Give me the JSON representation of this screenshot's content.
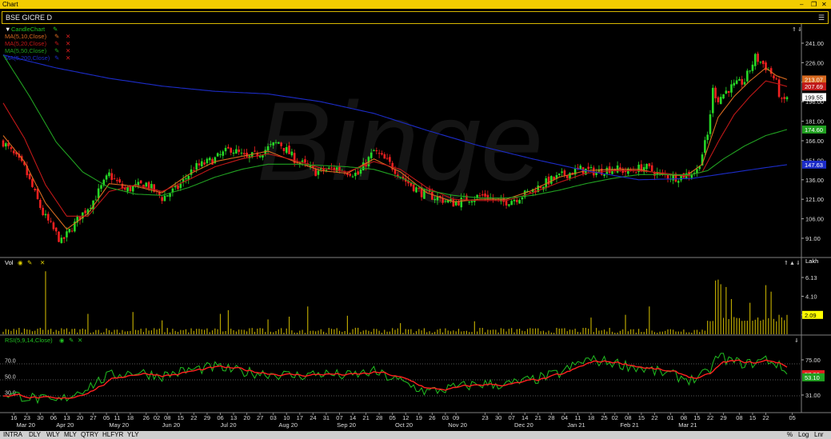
{
  "window": {
    "title": "Chart"
  },
  "symbol_bar": {
    "symbol": "BSE GICRE D"
  },
  "watermark": "Binge",
  "price_panel": {
    "label": "CandleChart",
    "indicators": [
      {
        "label": "MA(5,10,Close)",
        "color": "#d86a20"
      },
      {
        "label": "MA(5,20,Close)",
        "color": "#c01818"
      },
      {
        "label": "MA(5,50,Close)",
        "color": "#21a021"
      },
      {
        "label": "MA(5,200,Close)",
        "color": "#1c2cc8"
      }
    ],
    "yticks": [
      "241.00",
      "226.00",
      "211.00",
      "196.00",
      "181.00",
      "166.00",
      "151.00",
      "136.00",
      "121.00",
      "106.00",
      "91.00"
    ],
    "price_tags": [
      {
        "text": "213.07",
        "value": 213.07,
        "bg": "#d86a20"
      },
      {
        "text": "207.69",
        "value": 207.69,
        "bg": "#c01818"
      },
      {
        "text": "199.55",
        "value": 199.55,
        "bg": "#ffffff"
      },
      {
        "text": "174.60",
        "value": 174.6,
        "bg": "#21a021"
      },
      {
        "text": "147.63",
        "value": 147.63,
        "bg": "#1c2cc8"
      }
    ]
  },
  "volume_panel": {
    "label": "Vol",
    "unit": "Lakh",
    "yticks": [
      "6.13",
      "4.10",
      "2.09"
    ],
    "last_value": "2.09"
  },
  "rsi_panel": {
    "label": "RSI(5,9,14,Close)",
    "yticks": [
      "75.00",
      "31.00"
    ],
    "levels": [
      "70.0",
      "50.0",
      "30.0"
    ],
    "tags": [
      {
        "text": "57.06",
        "value": 57.06,
        "bg": "#e02020"
      },
      {
        "text": "53.10",
        "value": 53.1,
        "bg": "#21a021"
      }
    ]
  },
  "chart_data": {
    "type": "candlestick",
    "title": "BSE GICRE D",
    "period": "Mar 2020 - Mar 2021 (daily)",
    "ylim": [
      80,
      250
    ],
    "close_anchors": [
      [
        0,
        165
      ],
      [
        8,
        145
      ],
      [
        15,
        110
      ],
      [
        22,
        88
      ],
      [
        28,
        105
      ],
      [
        34,
        120
      ],
      [
        40,
        140
      ],
      [
        46,
        128
      ],
      [
        54,
        133
      ],
      [
        60,
        122
      ],
      [
        66,
        130
      ],
      [
        72,
        145
      ],
      [
        80,
        152
      ],
      [
        86,
        160
      ],
      [
        92,
        152
      ],
      [
        98,
        158
      ],
      [
        104,
        165
      ],
      [
        110,
        152
      ],
      [
        118,
        142
      ],
      [
        126,
        145
      ],
      [
        134,
        140
      ],
      [
        140,
        158
      ],
      [
        146,
        148
      ],
      [
        152,
        135
      ],
      [
        158,
        126
      ],
      [
        164,
        122
      ],
      [
        170,
        118
      ],
      [
        176,
        122
      ],
      [
        182,
        124
      ],
      [
        188,
        118
      ],
      [
        194,
        122
      ],
      [
        200,
        128
      ],
      [
        206,
        135
      ],
      [
        212,
        140
      ],
      [
        218,
        144
      ],
      [
        224,
        142
      ],
      [
        230,
        145
      ],
      [
        236,
        142
      ],
      [
        242,
        146
      ],
      [
        248,
        140
      ],
      [
        254,
        138
      ],
      [
        258,
        140
      ],
      [
        262,
        143
      ],
      [
        266,
        170
      ],
      [
        268,
        205
      ],
      [
        270,
        198
      ],
      [
        274,
        206
      ],
      [
        280,
        212
      ],
      [
        284,
        230
      ],
      [
        287,
        225
      ],
      [
        290,
        218
      ],
      [
        292,
        210
      ],
      [
        294,
        195
      ],
      [
        296,
        199.55
      ]
    ],
    "moving_averages": {
      "MA10": [
        [
          0,
          170
        ],
        [
          8,
          150
        ],
        [
          16,
          118
        ],
        [
          24,
          98
        ],
        [
          32,
          110
        ],
        [
          40,
          133
        ],
        [
          50,
          131
        ],
        [
          60,
          126
        ],
        [
          70,
          140
        ],
        [
          80,
          150
        ],
        [
          90,
          154
        ],
        [
          100,
          158
        ],
        [
          110,
          150
        ],
        [
          120,
          143
        ],
        [
          130,
          141
        ],
        [
          140,
          152
        ],
        [
          150,
          142
        ],
        [
          160,
          126
        ],
        [
          170,
          119
        ],
        [
          180,
          121
        ],
        [
          190,
          121
        ],
        [
          200,
          128
        ],
        [
          210,
          138
        ],
        [
          220,
          143
        ],
        [
          230,
          144
        ],
        [
          240,
          144
        ],
        [
          250,
          140
        ],
        [
          258,
          139
        ],
        [
          264,
          148
        ],
        [
          270,
          184
        ],
        [
          276,
          200
        ],
        [
          282,
          212
        ],
        [
          288,
          222
        ],
        [
          292,
          216
        ],
        [
          296,
          213.07
        ]
      ],
      "MA20": [
        [
          0,
          195
        ],
        [
          8,
          168
        ],
        [
          16,
          132
        ],
        [
          24,
          108
        ],
        [
          32,
          108
        ],
        [
          40,
          127
        ],
        [
          50,
          132
        ],
        [
          60,
          127
        ],
        [
          70,
          136
        ],
        [
          80,
          146
        ],
        [
          90,
          152
        ],
        [
          100,
          156
        ],
        [
          110,
          151
        ],
        [
          120,
          145
        ],
        [
          130,
          142
        ],
        [
          140,
          150
        ],
        [
          150,
          144
        ],
        [
          160,
          130
        ],
        [
          170,
          121
        ],
        [
          180,
          120
        ],
        [
          190,
          120
        ],
        [
          200,
          126
        ],
        [
          210,
          134
        ],
        [
          220,
          141
        ],
        [
          230,
          143
        ],
        [
          240,
          143
        ],
        [
          250,
          141
        ],
        [
          258,
          139
        ],
        [
          264,
          142
        ],
        [
          270,
          165
        ],
        [
          276,
          186
        ],
        [
          282,
          200
        ],
        [
          288,
          212
        ],
        [
          292,
          210
        ],
        [
          296,
          207.69
        ]
      ],
      "MA50": [
        [
          0,
          232
        ],
        [
          10,
          200
        ],
        [
          20,
          165
        ],
        [
          30,
          142
        ],
        [
          40,
          130
        ],
        [
          50,
          125
        ],
        [
          60,
          124
        ],
        [
          70,
          130
        ],
        [
          80,
          138
        ],
        [
          90,
          144
        ],
        [
          100,
          148
        ],
        [
          110,
          148
        ],
        [
          120,
          147
        ],
        [
          130,
          146
        ],
        [
          140,
          144
        ],
        [
          150,
          138
        ],
        [
          160,
          128
        ],
        [
          170,
          124
        ],
        [
          180,
          122
        ],
        [
          190,
          122
        ],
        [
          200,
          124
        ],
        [
          210,
          128
        ],
        [
          220,
          133
        ],
        [
          230,
          137
        ],
        [
          240,
          140
        ],
        [
          250,
          140
        ],
        [
          260,
          140
        ],
        [
          266,
          143
        ],
        [
          272,
          152
        ],
        [
          280,
          162
        ],
        [
          288,
          170
        ],
        [
          296,
          174.6
        ]
      ],
      "MA200": [
        [
          0,
          232
        ],
        [
          20,
          222
        ],
        [
          40,
          214
        ],
        [
          60,
          208
        ],
        [
          80,
          204
        ],
        [
          100,
          202
        ],
        [
          120,
          196
        ],
        [
          140,
          187
        ],
        [
          160,
          174
        ],
        [
          180,
          162
        ],
        [
          200,
          152
        ],
        [
          220,
          143
        ],
        [
          240,
          136
        ],
        [
          260,
          137
        ],
        [
          280,
          143
        ],
        [
          296,
          147.63
        ]
      ]
    },
    "volume_spikes": [
      [
        16,
        6.8
      ],
      [
        32,
        2.2
      ],
      [
        49,
        2.4
      ],
      [
        60,
        1.5
      ],
      [
        82,
        2.2
      ],
      [
        85,
        2.6
      ],
      [
        100,
        1.6
      ],
      [
        108,
        1.9
      ],
      [
        115,
        3.0
      ],
      [
        130,
        2.0
      ],
      [
        150,
        1.2
      ],
      [
        178,
        1.4
      ],
      [
        222,
        1.8
      ],
      [
        235,
        2.1
      ],
      [
        244,
        3.0
      ],
      [
        269,
        5.8
      ],
      [
        270,
        5.9
      ],
      [
        271,
        5.4
      ],
      [
        273,
        5.1
      ],
      [
        275,
        3.8
      ],
      [
        282,
        3.4
      ],
      [
        288,
        5.3
      ],
      [
        290,
        4.6
      ],
      [
        293,
        2.1
      ],
      [
        296,
        2.09
      ]
    ],
    "rsi_anchors": [
      [
        0,
        33
      ],
      [
        10,
        28
      ],
      [
        20,
        22
      ],
      [
        30,
        38
      ],
      [
        40,
        55
      ],
      [
        50,
        60
      ],
      [
        60,
        55
      ],
      [
        70,
        62
      ],
      [
        80,
        66
      ],
      [
        90,
        60
      ],
      [
        100,
        58
      ],
      [
        110,
        55
      ],
      [
        120,
        58
      ],
      [
        130,
        55
      ],
      [
        140,
        60
      ],
      [
        150,
        48
      ],
      [
        160,
        35
      ],
      [
        170,
        40
      ],
      [
        180,
        45
      ],
      [
        190,
        44
      ],
      [
        200,
        50
      ],
      [
        210,
        58
      ],
      [
        220,
        75
      ],
      [
        230,
        72
      ],
      [
        240,
        65
      ],
      [
        250,
        58
      ],
      [
        260,
        50
      ],
      [
        266,
        58
      ],
      [
        270,
        80
      ],
      [
        276,
        72
      ],
      [
        282,
        70
      ],
      [
        288,
        76
      ],
      [
        292,
        70
      ],
      [
        296,
        57.06
      ]
    ],
    "x_ticks": [
      [
        "16",
        4
      ],
      [
        "23",
        9
      ],
      [
        "30",
        14
      ],
      [
        "06",
        19
      ],
      [
        "13",
        24
      ],
      [
        "20",
        29
      ],
      [
        "27",
        34
      ],
      [
        "05",
        39
      ],
      [
        "11",
        43
      ],
      [
        "18",
        48
      ],
      [
        "26",
        54
      ],
      [
        "02",
        58
      ],
      [
        "08",
        62
      ],
      [
        "15",
        67
      ],
      [
        "22",
        72
      ],
      [
        "29",
        77
      ],
      [
        "06",
        82
      ],
      [
        "13",
        87
      ],
      [
        "20",
        92
      ],
      [
        "27",
        97
      ],
      [
        "03",
        102
      ],
      [
        "10",
        107
      ],
      [
        "17",
        112
      ],
      [
        "24",
        117
      ],
      [
        "31",
        122
      ],
      [
        "07",
        127
      ],
      [
        "14",
        132
      ],
      [
        "21",
        137
      ],
      [
        "28",
        142
      ],
      [
        "05",
        147
      ],
      [
        "12",
        152
      ],
      [
        "19",
        157
      ],
      [
        "26",
        162
      ],
      [
        "03",
        167
      ],
      [
        "09",
        171
      ],
      [
        "23",
        182
      ],
      [
        "30",
        187
      ],
      [
        "07",
        192
      ],
      [
        "14",
        197
      ],
      [
        "21",
        202
      ],
      [
        "28",
        207
      ],
      [
        "04",
        212
      ],
      [
        "11",
        217
      ],
      [
        "18",
        222
      ],
      [
        "25",
        227
      ],
      [
        "02",
        231
      ],
      [
        "08",
        236
      ],
      [
        "15",
        241
      ],
      [
        "22",
        246
      ],
      [
        "01",
        252
      ],
      [
        "08",
        257
      ],
      [
        "15",
        262
      ],
      [
        "22",
        267
      ],
      [
        "29",
        272
      ],
      [
        "08",
        278
      ],
      [
        "15",
        283
      ],
      [
        "22",
        288
      ],
      [
        "05",
        298
      ]
    ],
    "month_labels": [
      [
        "Mar 20",
        5
      ],
      [
        "Apr 20",
        20
      ],
      [
        "May 20",
        40
      ],
      [
        "Jun 20",
        60
      ],
      [
        "Jul 20",
        82
      ],
      [
        "Aug 20",
        104
      ],
      [
        "Sep 20",
        126
      ],
      [
        "Oct 20",
        148
      ],
      [
        "Nov 20",
        168
      ],
      [
        "Dec 20",
        193
      ],
      [
        "Jan 21",
        213
      ],
      [
        "Feb 21",
        233
      ],
      [
        "Mar 21",
        255
      ]
    ]
  },
  "bottom_bar": {
    "timeframes": [
      "INTRA",
      "DLY",
      "WLY",
      "MLY",
      "QTRY",
      "HLFYR",
      "YLY"
    ],
    "right": [
      "%",
      "Log",
      "Lnr"
    ]
  }
}
